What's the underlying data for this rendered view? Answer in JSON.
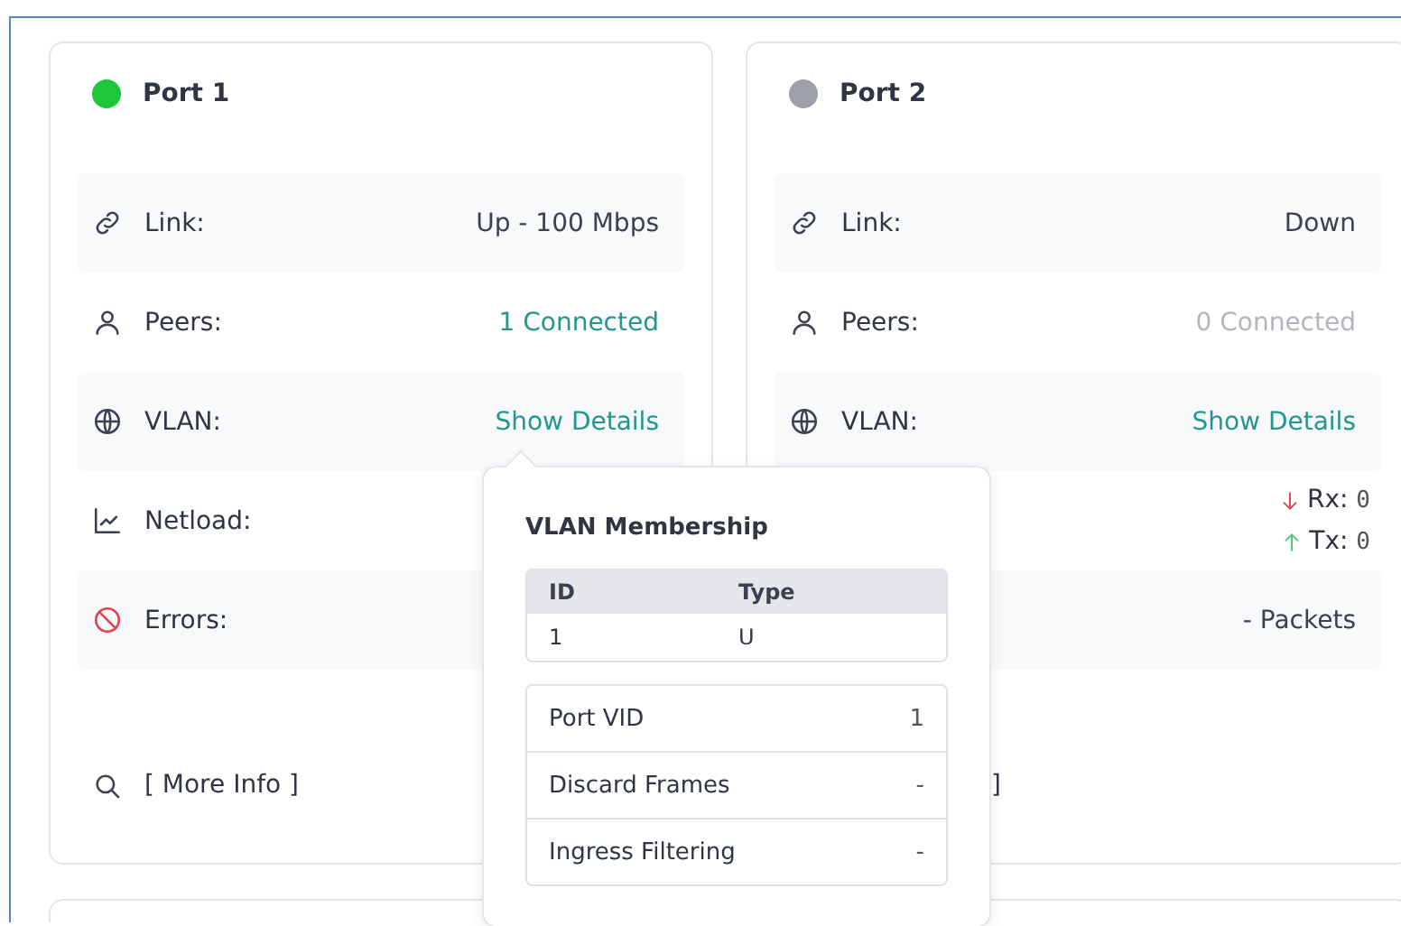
{
  "ports": [
    {
      "title": "Port 1",
      "color": "#1ec73a",
      "rows": [
        {
          "kind": "link",
          "label": "Link:",
          "value": {
            "kind": "plain",
            "text": "Up - 100 Mbps"
          }
        },
        {
          "kind": "peers",
          "label": "Peers:",
          "value": {
            "kind": "link",
            "text": "1 Connected"
          }
        },
        {
          "kind": "vlan",
          "label": "VLAN:",
          "value": {
            "kind": "link",
            "text": "Show Details"
          }
        },
        {
          "kind": "netload",
          "label": "Netload:"
        },
        {
          "kind": "errors",
          "label": "Errors:"
        }
      ],
      "more_info": {
        "text": "[ More Info ]",
        "covered": false
      }
    },
    {
      "title": "Port 2",
      "color": "#9ca0aa",
      "rows": [
        {
          "kind": "link",
          "label": "Link:",
          "value": {
            "kind": "plain",
            "text": "Down"
          }
        },
        {
          "kind": "peers",
          "label": "Peers:",
          "value": {
            "kind": "muted",
            "text": "0 Connected"
          }
        },
        {
          "kind": "vlan",
          "label": "VLAN:",
          "value": {
            "kind": "link",
            "text": "Show Details"
          }
        },
        {
          "kind": "netload",
          "value": {
            "kind": "traffic",
            "rx_label": "Rx:",
            "rx": "0",
            "tx_label": "Tx:",
            "tx": "0"
          }
        },
        {
          "kind": "errors",
          "value": {
            "kind": "plain",
            "text": "- Packets"
          }
        }
      ],
      "more_info": {
        "text": "]",
        "covered": true
      }
    }
  ],
  "vlan_popover": {
    "title": "VLAN Membership",
    "table": {
      "columns": [
        "ID",
        "Type"
      ],
      "rows": [
        [
          "1",
          "U"
        ]
      ]
    },
    "settings": [
      {
        "label": "Port VID",
        "value": "1"
      },
      {
        "label": "Discard Frames",
        "value": "-"
      },
      {
        "label": "Ingress Filtering",
        "value": "-"
      }
    ]
  }
}
